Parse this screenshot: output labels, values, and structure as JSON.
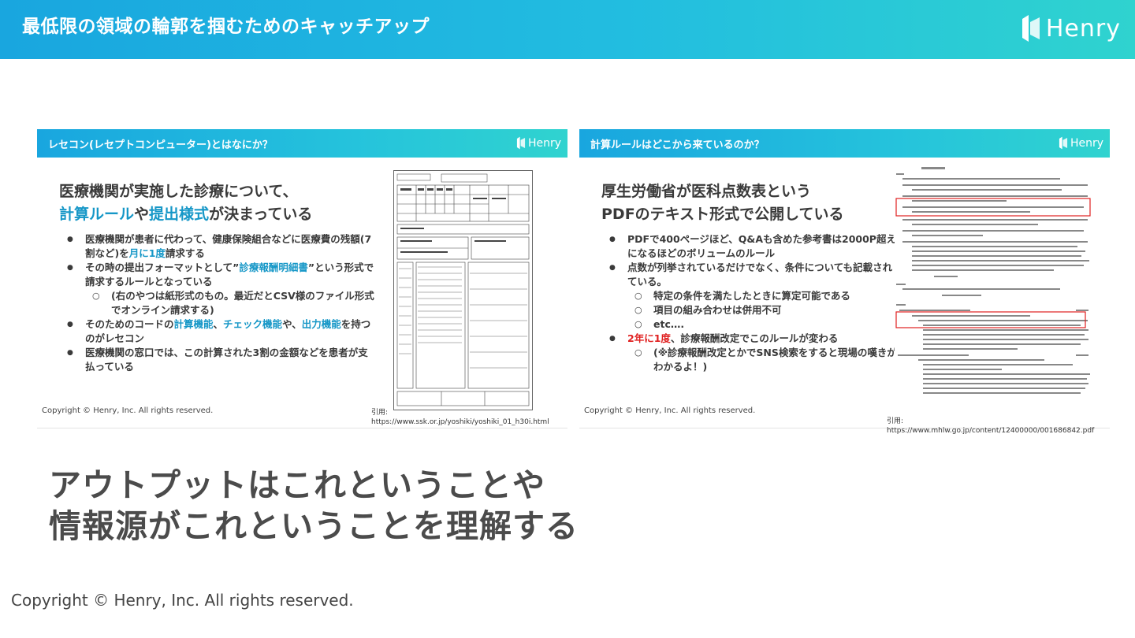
{
  "header": {
    "title": "最低限の領域の輪郭を掴むためのキャッチアップ",
    "brand": "Henry"
  },
  "slides": [
    {
      "title": "レセコン(レセプトコンピューター)とはなにか？",
      "brand": "Henry",
      "heading": {
        "line1": "医療機関が実施した診療について、",
        "line2_hl1": "計算ルール",
        "line2_mid": "や",
        "line2_hl2": "提出様式",
        "line2_end": "が決まっている"
      },
      "bullets": [
        {
          "pre": "医療機関が患者に代わって、健康保険組合などに医療費の残額(7割など)を",
          "acc": "月に1度",
          "post": "請求する"
        },
        {
          "pre": "その時の提出フォーマットとして”",
          "acc": "診療報酬明細書",
          "post": "”という形式で請求するルールとなっている"
        },
        {
          "sub": "(右のやつは紙形式のもの。最近だとCSV様のファイル形式でオンライン請求する)"
        },
        {
          "pre": "そのためのコードの",
          "acc": "計算機能",
          "mid1": "、",
          "acc2": "チェック機能",
          "mid2": "や、",
          "acc3": "出力機能",
          "post": "を持つのがレセコン"
        },
        {
          "text": "医療機関の窓口では、この計算された3割の金額などを患者が支払っている"
        }
      ],
      "copyright": "Copyright © Henry, Inc. All rights reserved.",
      "cite_label": "引用:",
      "cite_url": "https://www.ssk.or.jp/yoshiki/yoshiki_01_h30i.html"
    },
    {
      "title": "計算ルールはどこから来ているのか？",
      "brand": "Henry",
      "heading": {
        "line1": "厚生労働省が医科点数表という",
        "line2": "PDFのテキスト形式で公開している"
      },
      "bullets": [
        {
          "text": "PDFで400ページほど、Q&Aも含めた参考書は2000P超えになるほどのボリュームのルール"
        },
        {
          "text": "点数が列挙されているだけでなく、条件についても記載されている。"
        },
        {
          "sub": "特定の条件を満たしたときに算定可能である"
        },
        {
          "sub": "項目の組み合わせは併用不可"
        },
        {
          "sub": "etc…."
        },
        {
          "red": "2年に1度",
          "post": "、診療報酬改定でこのルールが変わる"
        },
        {
          "sub": "(※診療報酬改定とかでSNS検索をすると現場の嘆きがわかるよ！)"
        }
      ],
      "copyright": "Copyright © Henry, Inc. All rights reserved.",
      "cite": "引用: https://www.mhlw.go.jp/content/12400000/001686842.pdf"
    }
  ],
  "main": {
    "line1": "アウトプットはこれということや",
    "line2": "情報源がこれということを理解する"
  },
  "footer": {
    "copyright": "Copyright © Henry, Inc. All rights reserved."
  },
  "colors": {
    "accent": "#1697c7",
    "highlight_red": "#e02020",
    "header_start": "#19a6df",
    "header_end": "#2fd3cf"
  }
}
